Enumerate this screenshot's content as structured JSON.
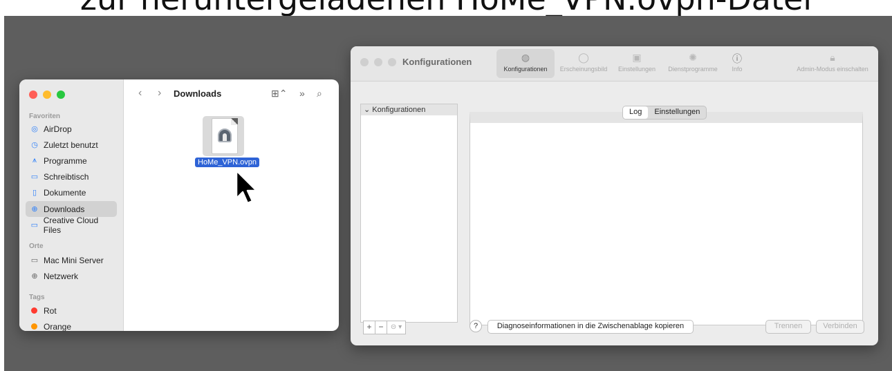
{
  "caption": "zur heruntergeladenen HoMe_VPN.ovpn-Datei",
  "finder": {
    "title": "Downloads",
    "nav_back": "‹",
    "nav_forward": "›",
    "sections": {
      "favorites": "Favoriten",
      "locations": "Orte",
      "tags": "Tags"
    },
    "favorites": [
      {
        "label": "AirDrop",
        "icon": "airdrop-icon"
      },
      {
        "label": "Zuletzt benutzt",
        "icon": "clock-icon"
      },
      {
        "label": "Programme",
        "icon": "apps-icon"
      },
      {
        "label": "Schreibtisch",
        "icon": "desktop-icon"
      },
      {
        "label": "Dokumente",
        "icon": "document-icon"
      },
      {
        "label": "Downloads",
        "icon": "download-icon",
        "selected": true
      },
      {
        "label": "Creative Cloud Files",
        "icon": "folder-icon"
      }
    ],
    "locations": [
      {
        "label": "Mac Mini Server",
        "icon": "computer-icon"
      },
      {
        "label": "Netzwerk",
        "icon": "globe-icon"
      }
    ],
    "tags": [
      {
        "label": "Rot",
        "color": "#ff3b30"
      },
      {
        "label": "Orange",
        "color": "#ff9500"
      }
    ],
    "file": {
      "name": "HoMe_VPN.ovpn"
    }
  },
  "tunnelblick": {
    "title": "Konfigurationen",
    "toolbar": [
      {
        "label": "Konfigurationen",
        "icon": "vpn-icon",
        "active": true
      },
      {
        "label": "Erscheinungsbild",
        "icon": "appearance-icon"
      },
      {
        "label": "Einstellungen",
        "icon": "settings-icon"
      },
      {
        "label": "Dienstprogramme",
        "icon": "gear-icon"
      },
      {
        "label": "Info",
        "icon": "info-icon"
      },
      {
        "label": "Admin-Modus einschalten",
        "icon": "lock-icon"
      }
    ],
    "list_header": "Konfigurationen",
    "tabs": {
      "log": "Log",
      "settings": "Einstellungen"
    },
    "help": "?",
    "list_buttons": {
      "add": "+",
      "remove": "−",
      "more": "⊝ ▾"
    },
    "buttons": {
      "diagnostics": "Diagnoseinformationen in die Zwischenablage kopieren",
      "disconnect": "Trennen",
      "connect": "Verbinden"
    }
  }
}
